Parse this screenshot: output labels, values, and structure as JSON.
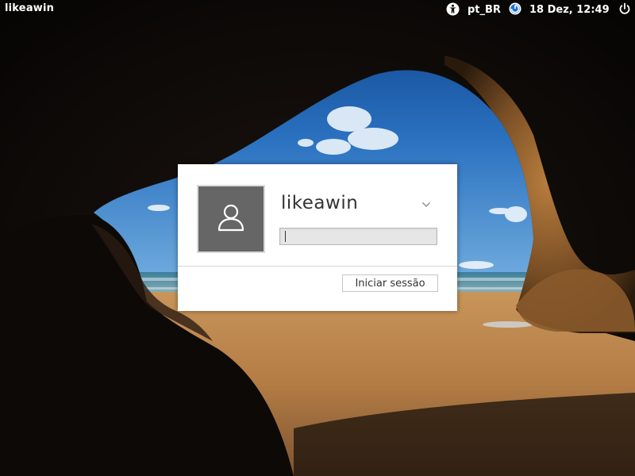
{
  "panel": {
    "hostname": "likeawin",
    "keyboard_layout": "pt_BR",
    "clock": "18 Dez, 12:49",
    "icons": {
      "accessibility": "accessibility-icon",
      "session": "session-icon",
      "power": "power-icon"
    }
  },
  "login": {
    "username": "likeawin",
    "password_value": "",
    "login_button_label": "Iniciar sessão",
    "avatar_icon": "user-silhouette-icon",
    "dropdown_icon": "chevron-down-icon"
  },
  "colors": {
    "panel_text": "#ffffff",
    "avatar_bg": "#666666",
    "dialog_bg": "#ffffff",
    "field_bg": "#e6e6e6"
  }
}
